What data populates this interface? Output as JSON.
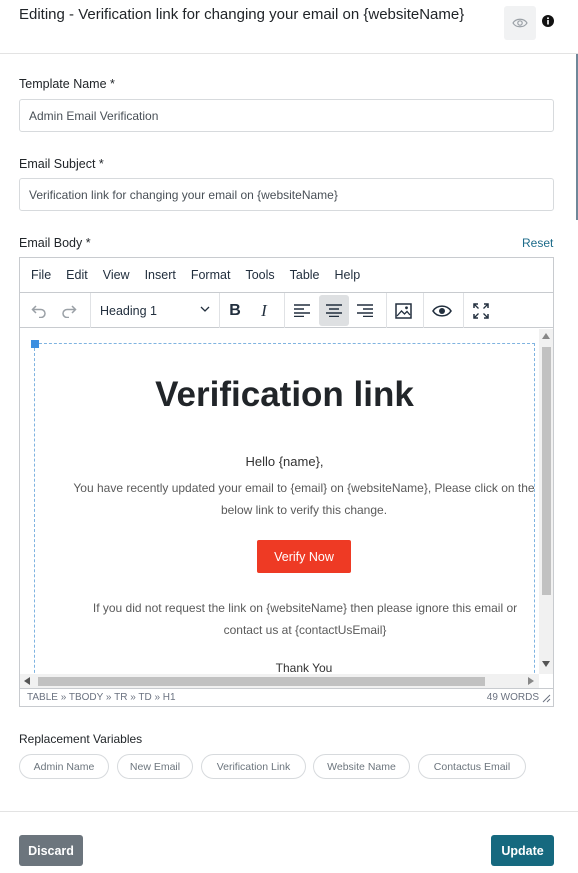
{
  "header": {
    "title": "Editing - Verification link for changing your email on {websiteName}"
  },
  "form": {
    "template_name_label": "Template Name *",
    "template_name_value": "Admin Email Verification",
    "subject_label": "Email Subject *",
    "subject_value": "Verification link for changing your email on {websiteName}",
    "body_label": "Email Body *",
    "reset_label": "Reset"
  },
  "editor": {
    "menus": [
      "File",
      "Edit",
      "View",
      "Insert",
      "Format",
      "Tools",
      "Table",
      "Help"
    ],
    "block_format": "Heading 1",
    "content": {
      "title": "Verification link",
      "hello": "Hello {name},",
      "text1": "You have recently updated your email to {email} on {websiteName}, Please click on the below link to verify this change.",
      "button": "Verify Now",
      "text2": "If you did not request the link on {websiteName} then please ignore this email or contact us at {contactUsEmail}",
      "thanks": "Thank You"
    },
    "status_path": "TABLE » TBODY » TR » TD » H1",
    "word_count": "49 WORDS"
  },
  "variables": {
    "label": "Replacement Variables",
    "chips": [
      "Admin Name",
      "New Email",
      "Verification Link",
      "Website Name",
      "Contactus Email"
    ]
  },
  "footer": {
    "discard_label": "Discard",
    "update_label": "Update"
  },
  "colors": {
    "accent": "#16697f",
    "verify_button": "#ee3a24",
    "discard": "#6c757d",
    "reset_link": "#1c6b8a"
  },
  "icons": [
    "eye-icon",
    "info-icon",
    "undo-icon",
    "redo-icon",
    "chevron-down-icon",
    "bold-icon",
    "italic-icon",
    "align-left-icon",
    "align-center-icon",
    "align-right-icon",
    "image-icon",
    "preview-icon",
    "fullscreen-icon",
    "resize-handle-icon"
  ]
}
